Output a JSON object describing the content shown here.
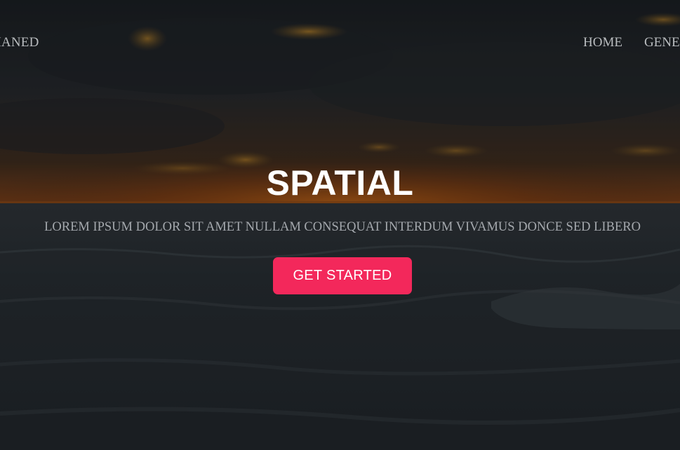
{
  "header": {
    "brand": "HANED",
    "nav": [
      "HOME",
      "GENE"
    ]
  },
  "hero": {
    "title": "SPATIAL",
    "subtitle": "LOREM IPSUM DOLOR SIT AMET NULLAM CONSEQUAT INTERDUM VIVAMUS DONCE SED LIBERO",
    "cta_label": "GET STARTED"
  },
  "colors": {
    "accent": "#f3285b",
    "overlay": "#1b1e22",
    "nav_text": "#b9bcbf",
    "subtitle_text": "#a4a8ad"
  }
}
